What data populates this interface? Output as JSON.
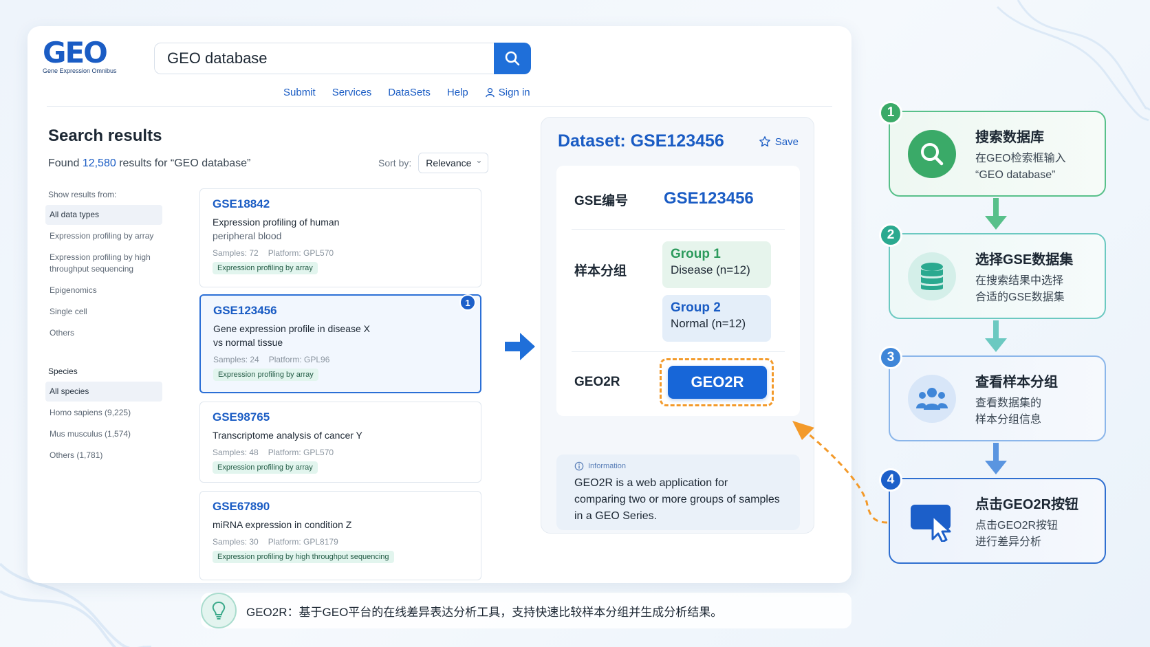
{
  "logo": {
    "text": "GEO",
    "subtitle": "Gene Expression Omnibus"
  },
  "search": {
    "value": "GEO database"
  },
  "nav": {
    "items": [
      "Submit",
      "Services",
      "DataSets",
      "Help"
    ],
    "signin": "Sign in"
  },
  "results": {
    "title": "Search results",
    "found_prefix": "Found ",
    "count": "12,580",
    "found_suffix": " results for “GEO database”",
    "sort_label": "Sort by:",
    "sort_value": "Relevance"
  },
  "filters": {
    "data_types_head": "Show results from:",
    "data_types": [
      "All data types",
      "Expression profiling by array",
      "Expression profiling by high throughput sequencing",
      "Epigenomics",
      "Single cell",
      "Others"
    ],
    "species_head": "Species",
    "species": [
      "All species",
      "Homo sapiens (9,225)",
      "Mus musculus (1,574)",
      "Others (1,781)"
    ]
  },
  "result_items": [
    {
      "id": "GSE18842",
      "desc1": "Expression profiling of human",
      "desc2": "peripheral blood",
      "samples": "Samples: 72",
      "platform": "Platform: GPL570",
      "tag": "Expression profiling by array"
    },
    {
      "id": "GSE123456",
      "desc1": "Gene expression profile in disease X",
      "desc2": "vs normal tissue",
      "samples": "Samples: 24",
      "platform": "Platform: GPL96",
      "tag": "Expression profiling by array",
      "badge": "1"
    },
    {
      "id": "GSE98765",
      "desc1": "Transcriptome analysis of cancer Y",
      "samples": "Samples: 48",
      "platform": "Platform: GPL570",
      "tag": "Expression profiling by array"
    },
    {
      "id": "GSE67890",
      "desc1": "miRNA expression in condition Z",
      "samples": "Samples: 30",
      "platform": "Platform: GPL8179",
      "tag": "Expression profiling by high throughput sequencing"
    }
  ],
  "dataset": {
    "title": "Dataset: GSE123456",
    "save": "Save",
    "gse_label": "GSE编号",
    "gse_value": "GSE123456",
    "group_label": "样本分组",
    "group1_name": "Group 1",
    "group1_desc": "Disease (n=12)",
    "group2_name": "Group 2",
    "group2_desc": "Normal (n=12)",
    "geo2r_label": "GEO2R",
    "geo2r_button": "GEO2R",
    "info_head": "Information",
    "info_text": "GEO2R is a web application for comparing two or more groups of samples in a GEO Series."
  },
  "bottom_note": "GEO2R：基于GEO平台的在线差异表达分析工具，支持快速比较样本分组并生成分析结果。",
  "steps": [
    {
      "num": "1",
      "title": "搜索数据库",
      "desc1": "在GEO检索框输入",
      "desc2": "“GEO database”",
      "icon": "search-icon"
    },
    {
      "num": "2",
      "title": "选择GSE数据集",
      "desc1": "在搜索结果中选择",
      "desc2": "合适的GSE数据集",
      "icon": "database-icon"
    },
    {
      "num": "3",
      "title": "查看样本分组",
      "desc1": "查看数据集的",
      "desc2": "样本分组信息",
      "icon": "users-icon"
    },
    {
      "num": "4",
      "title": "点击GEO2R按钮",
      "desc1": "点击GEO2R按钮",
      "desc2": "进行差异分析",
      "icon": "cursor-click-icon"
    }
  ],
  "colors": {
    "brand": "#1a5cc4",
    "accent_orange": "#f39a2a",
    "green": "#3aaa68",
    "teal": "#2aa98f"
  }
}
